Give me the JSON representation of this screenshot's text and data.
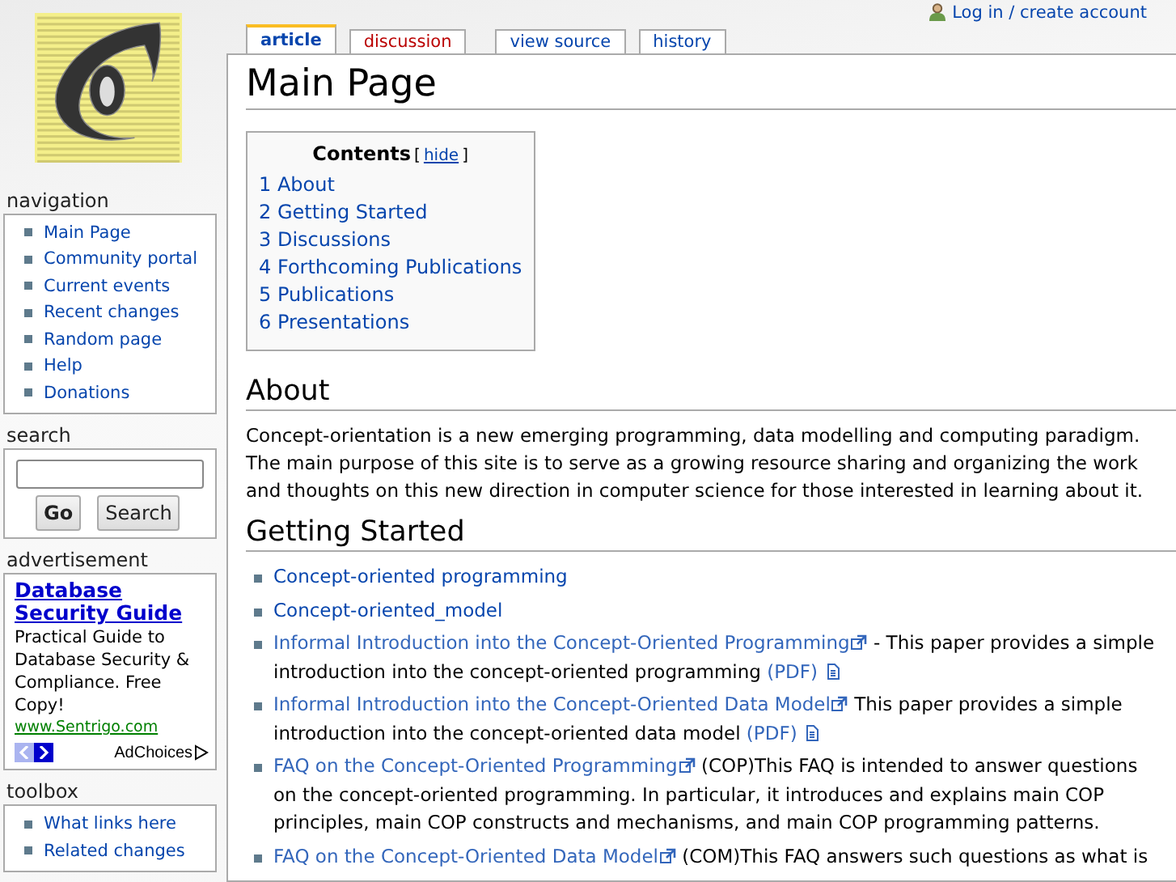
{
  "personal": {
    "login": "Log in / create account"
  },
  "tabs": [
    {
      "label": "article",
      "selected": true,
      "missing": false
    },
    {
      "label": "discussion",
      "selected": false,
      "missing": true
    },
    {
      "label": "view source",
      "selected": false,
      "missing": false
    },
    {
      "label": "history",
      "selected": false,
      "missing": false
    }
  ],
  "sidebar": {
    "navigation": {
      "title": "navigation",
      "items": [
        "Main Page",
        "Community portal",
        "Current events",
        "Recent changes",
        "Random page",
        "Help",
        "Donations"
      ]
    },
    "search": {
      "title": "search",
      "buttons": [
        "Go",
        "Search"
      ]
    },
    "advertisement": {
      "title": "advertisement",
      "headline": "Database Security Guide",
      "body": "Practical Guide to Database Security & Compliance. Free Copy!",
      "url": "www.Sentrigo.com",
      "adchoices": "AdChoices"
    },
    "toolbox": {
      "title": "toolbox",
      "items": [
        "What links here",
        "Related changes"
      ]
    }
  },
  "title": "Main Page",
  "toc": {
    "title": "Contents",
    "toggle": "hide",
    "bracket_open": "[",
    "bracket_close": "]",
    "items": [
      {
        "number": "1",
        "label": "About"
      },
      {
        "number": "2",
        "label": "Getting Started"
      },
      {
        "number": "3",
        "label": "Discussions"
      },
      {
        "number": "4",
        "label": "Forthcoming Publications"
      },
      {
        "number": "5",
        "label": "Publications"
      },
      {
        "number": "6",
        "label": "Presentations"
      }
    ]
  },
  "sections": [
    {
      "heading": "About",
      "paragraph": "Concept-orientation is a new emerging programming, data modelling and computing paradigm. The main purpose of this site is to serve as a growing resource sharing and organizing the work and thoughts on this new direction in computer science for those interested in learning about it."
    },
    {
      "heading": "Getting Started",
      "items": [
        {
          "parts": [
            {
              "kind": "link",
              "text": "Concept-oriented programming"
            }
          ]
        },
        {
          "parts": [
            {
              "kind": "link",
              "text": "Concept-oriented_model"
            }
          ]
        },
        {
          "parts": [
            {
              "kind": "external",
              "text": "Informal Introduction into the Concept-Oriented Programming"
            },
            {
              "kind": "text",
              "text": " - This paper provides a simple introduction into the concept-oriented programming "
            },
            {
              "kind": "file",
              "text": "(PDF)"
            }
          ]
        },
        {
          "parts": [
            {
              "kind": "external",
              "text": "Informal Introduction into the Concept-Oriented Data Model"
            },
            {
              "kind": "text",
              "text": " This paper provides a simple introduction into the concept-oriented data model "
            },
            {
              "kind": "file",
              "text": "(PDF)"
            }
          ]
        },
        {
          "parts": [
            {
              "kind": "external",
              "text": "FAQ on the Concept-Oriented Programming"
            },
            {
              "kind": "text",
              "text": " (COP)This FAQ is intended to answer questions on the concept-oriented programming. In particular, it introduces and explains main COP principles, main COP constructs and mechanisms, and main COP programming patterns."
            }
          ]
        },
        {
          "parts": [
            {
              "kind": "external",
              "text": "FAQ on the Concept-Oriented Data Model"
            },
            {
              "kind": "text",
              "text": " (COM)This FAQ answers such questions as what is"
            }
          ]
        }
      ]
    }
  ]
}
